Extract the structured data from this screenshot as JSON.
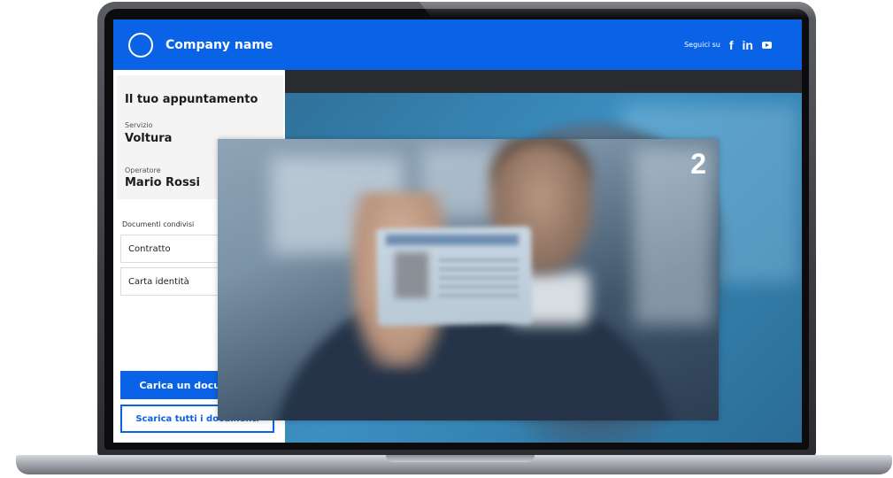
{
  "header": {
    "company_name": "Company name",
    "follow_label": "Seguici su",
    "social": [
      "facebook-icon",
      "linkedin-icon",
      "youtube-icon"
    ]
  },
  "appointment": {
    "title": "Il tuo appuntamento",
    "service_label": "Servizio",
    "service_value": "Voltura",
    "operator_label": "Operatore",
    "operator_value": "Mario Rossi"
  },
  "shared_docs": {
    "label": "Documenti condivisi",
    "items": [
      "Contratto",
      "Carta identità"
    ]
  },
  "actions": {
    "upload_label": "Carica un documento",
    "download_all_label": "Scarica tutti i documenti"
  },
  "video": {
    "overlay_number": "2"
  },
  "colors": {
    "brand": "#0a62e6",
    "video_topbar": "#2a2b2e"
  }
}
